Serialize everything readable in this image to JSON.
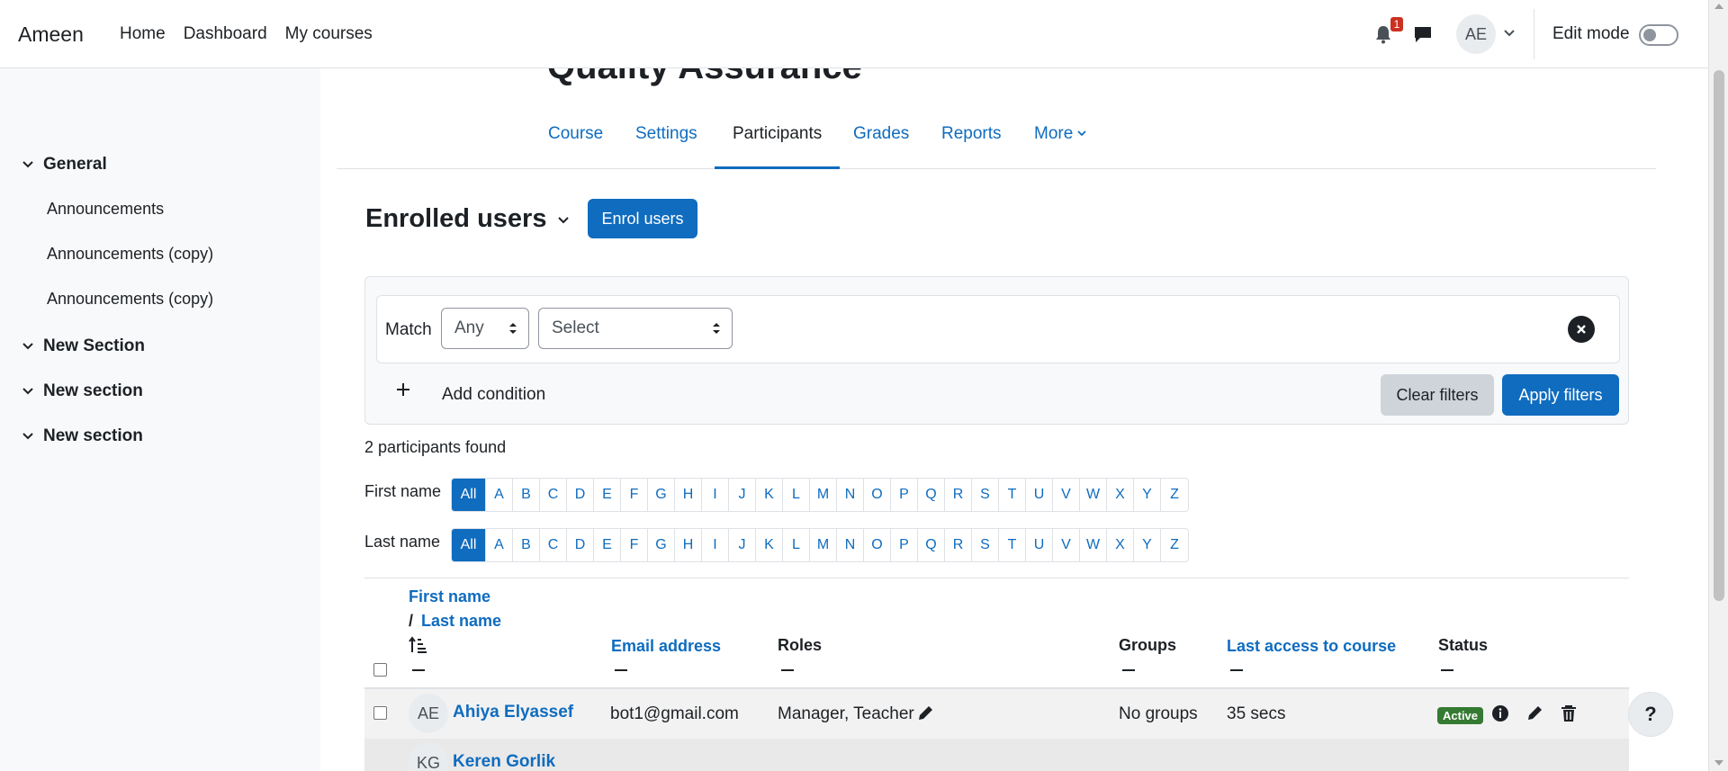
{
  "navbar": {
    "brand": "Ameen",
    "links": [
      "Home",
      "Dashboard",
      "My courses"
    ],
    "notification_count": "1",
    "avatar_initials": "AE",
    "edit_mode_label": "Edit mode",
    "edit_mode_on": false
  },
  "drawer": {
    "sections": [
      {
        "label": "General",
        "activities": [
          "Announcements",
          "Announcements (copy)",
          "Announcements (copy)"
        ]
      },
      {
        "label": "New Section",
        "activities": []
      },
      {
        "label": "New section",
        "activities": []
      },
      {
        "label": "New section",
        "activities": []
      }
    ]
  },
  "course": {
    "title": "Quality Assurance",
    "tabs": [
      "Course",
      "Settings",
      "Participants",
      "Grades",
      "Reports",
      "More"
    ],
    "active_tab": "Participants"
  },
  "participants": {
    "heading": "Enrolled users",
    "enrol_button": "Enrol users",
    "filter": {
      "match_label": "Match",
      "match_value": "Any",
      "select_value": "Select",
      "add_condition": "Add condition",
      "clear_button": "Clear filters",
      "apply_button": "Apply filters"
    },
    "found_text": "2 participants found",
    "first_name_label": "First name",
    "last_name_label": "Last name",
    "initials": [
      "All",
      "A",
      "B",
      "C",
      "D",
      "E",
      "F",
      "G",
      "H",
      "I",
      "J",
      "K",
      "L",
      "M",
      "N",
      "O",
      "P",
      "Q",
      "R",
      "S",
      "T",
      "U",
      "V",
      "W",
      "X",
      "Y",
      "Z"
    ],
    "table": {
      "headers": {
        "first_name": "First name",
        "slash": "/",
        "last_name": "Last name",
        "email": "Email address",
        "roles": "Roles",
        "groups": "Groups",
        "last_access": "Last access to course",
        "status": "Status"
      },
      "rows": [
        {
          "initials": "AE",
          "name": "Ahiya Elyassef",
          "email": "bot1@gmail.com",
          "roles": "Manager, Teacher",
          "groups": "No groups",
          "last_access": "35 secs",
          "status": "Active"
        },
        {
          "initials": "KG",
          "name": "Keren Gorlik",
          "email": "",
          "roles": "",
          "groups": "",
          "last_access": "",
          "status": ""
        }
      ]
    }
  },
  "help_button": "?",
  "colors": {
    "primary": "#0f6cbf",
    "active_badge": "#357a32",
    "drawer_bg": "#f8f9fa"
  }
}
